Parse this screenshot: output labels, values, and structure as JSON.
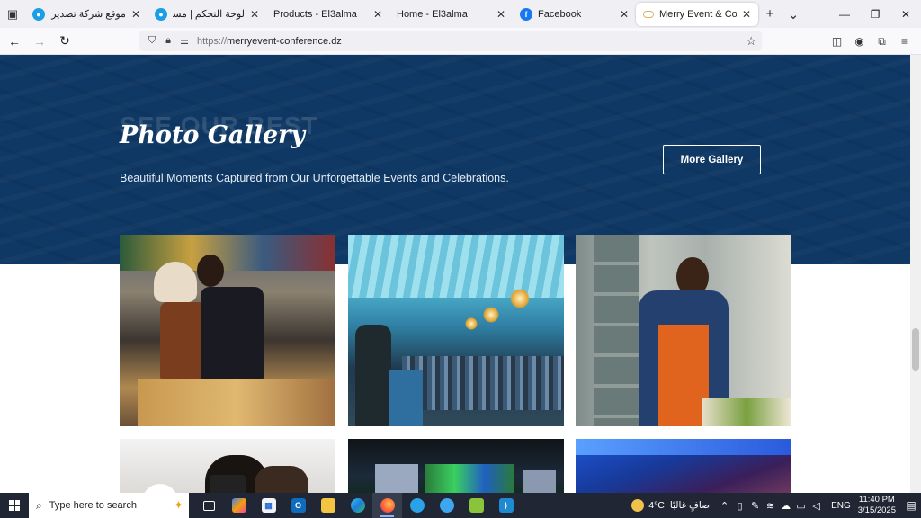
{
  "browser": {
    "tabs": [
      {
        "title": "موقع شركة تصدير التمور باب",
        "favicon": "circle-icon",
        "favicon_color": "#1a9ee8"
      },
      {
        "title": "لوحة التحكم | مستقل",
        "favicon": "circle-icon",
        "favicon_color": "#1a9ee8"
      },
      {
        "title": "Products - El3alma",
        "favicon": "",
        "favicon_color": ""
      },
      {
        "title": "Home - El3alma",
        "favicon": "",
        "favicon_color": ""
      },
      {
        "title": "Facebook",
        "favicon": "facebook-icon",
        "favicon_color": "#1877f2"
      },
      {
        "title": "Merry Event & Conference",
        "favicon": "merry-logo-icon",
        "favicon_color": "#e0b060"
      }
    ],
    "url_scheme": "https://",
    "url_host": "merryevent-conference.dz"
  },
  "page": {
    "ghost_title": "SEE OUR BEST",
    "title": "Photo Gallery",
    "subtitle": "Beautiful Moments Captured from Our Unforgettable Events and Celebrations.",
    "more_button": "More Gallery",
    "hero_color": "#0f3864"
  },
  "taskbar": {
    "search_placeholder": "Type here to search",
    "apps": [
      "task-view-icon",
      "copilot-icon",
      "store-icon",
      "outlook-icon",
      "file-explorer-icon",
      "edge-icon",
      "firefox-icon",
      "app-blue-icon",
      "app-globe-icon",
      "app-green-icon",
      "vscode-icon"
    ],
    "weather_temp": "4°C",
    "weather_text": "صافٍ غالبًا",
    "language": "ENG",
    "time": "11:40 PM",
    "date": "3/15/2025"
  }
}
